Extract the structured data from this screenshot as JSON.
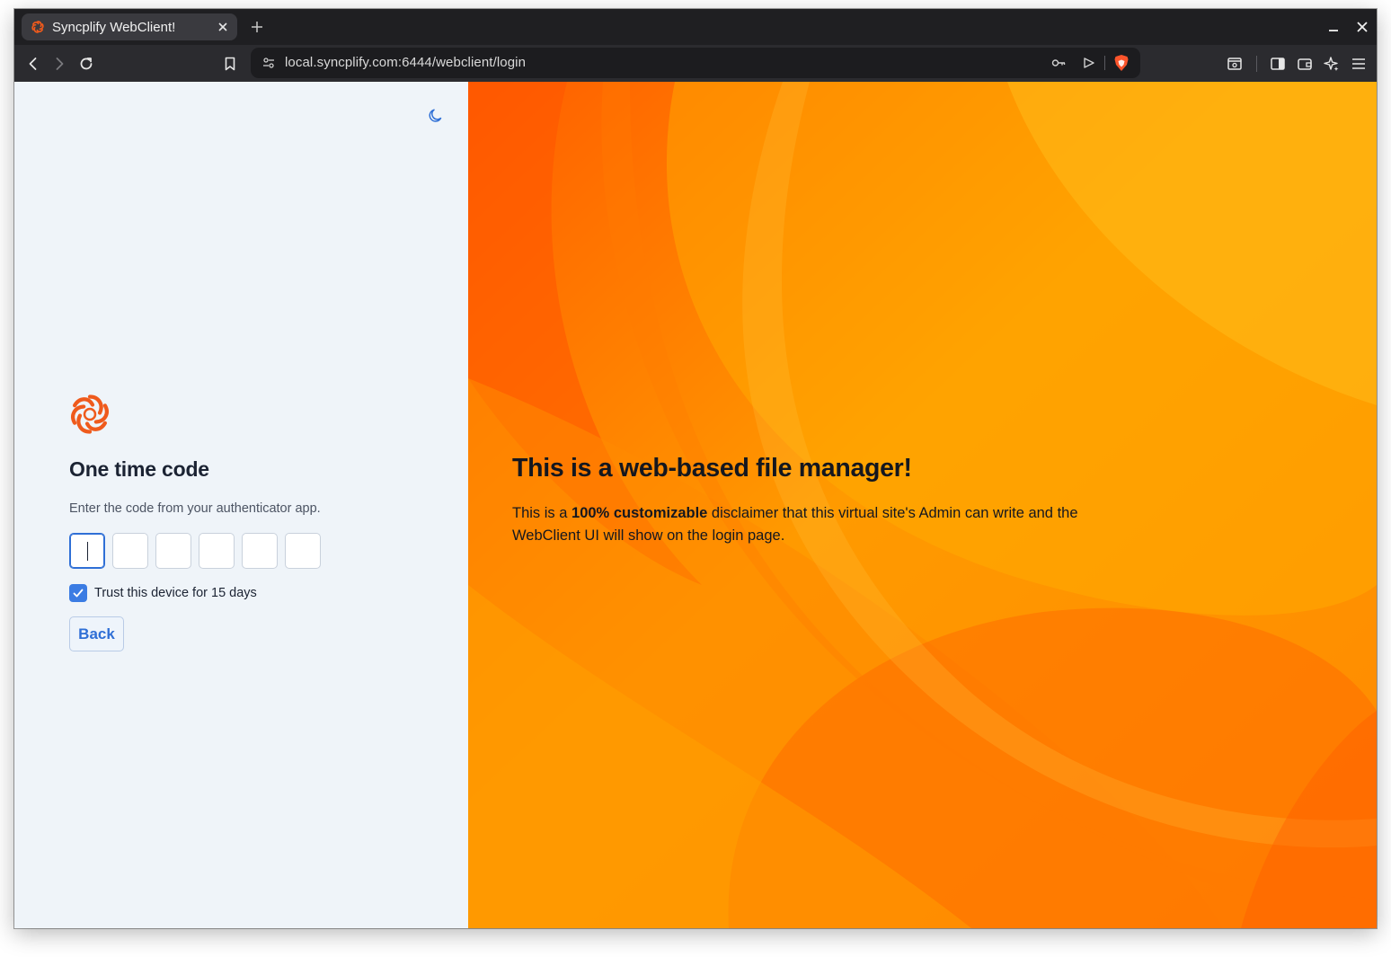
{
  "browser": {
    "tab": {
      "title": "Syncplify WebClient!"
    },
    "address_bar": {
      "url": "local.syncplify.com:6444/webclient/login"
    }
  },
  "login": {
    "title": "One time code",
    "subtitle": "Enter the code from your authenticator app.",
    "otp_digits": [
      "",
      "",
      "",
      "",
      "",
      ""
    ],
    "trust_label": "Trust this device for 15 days",
    "trust_checked": true,
    "back_label": "Back"
  },
  "disclaimer": {
    "title": "This is a web-based file manager!",
    "text_before": "This is a ",
    "text_bold": "100% customizable",
    "text_after": " disclaimer that this virtual site's Admin can write and the WebClient UI will show on the login page."
  },
  "colors": {
    "brand_orange": "#ef5a1c",
    "accent_blue": "#3b7ce3",
    "left_bg": "#eff4f9"
  }
}
